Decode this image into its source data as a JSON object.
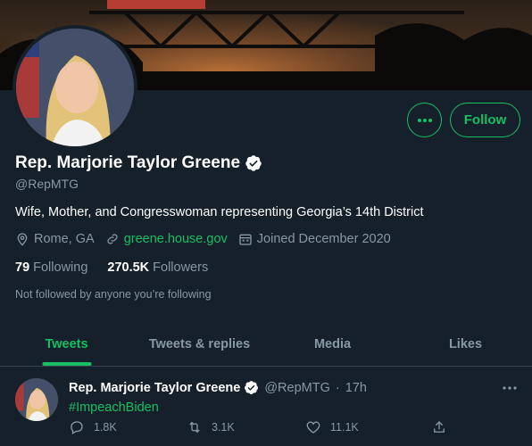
{
  "profile": {
    "name": "Rep. Marjorie Taylor Greene",
    "handle": "@RepMTG",
    "bio": "Wife, Mother, and Congresswoman representing Georgia’s 14th District",
    "location": "Rome, GA",
    "website": "greene.house.gov",
    "joined": "Joined December 2020",
    "following_count": "79",
    "following_label": "Following",
    "followers_count": "270.5K",
    "followers_label": "Followers",
    "not_followed": "Not followed by anyone you’re following"
  },
  "actions": {
    "follow_label": "Follow",
    "more_icon": "more-horizontal-icon"
  },
  "tabs": [
    {
      "label": "Tweets",
      "active": true
    },
    {
      "label": "Tweets & replies",
      "active": false
    },
    {
      "label": "Media",
      "active": false
    },
    {
      "label": "Likes",
      "active": false
    }
  ],
  "tweet": {
    "name": "Rep. Marjorie Taylor Greene",
    "handle": "@RepMTG",
    "separator": "·",
    "time": "17h",
    "text": "#ImpeachBiden",
    "replies": "1.8K",
    "retweets": "3.1K",
    "likes": "11.1K"
  },
  "colors": {
    "background": "#15202b",
    "accent": "#17bf63",
    "secondary_text": "#8899a6",
    "verified": "#ffffff"
  }
}
